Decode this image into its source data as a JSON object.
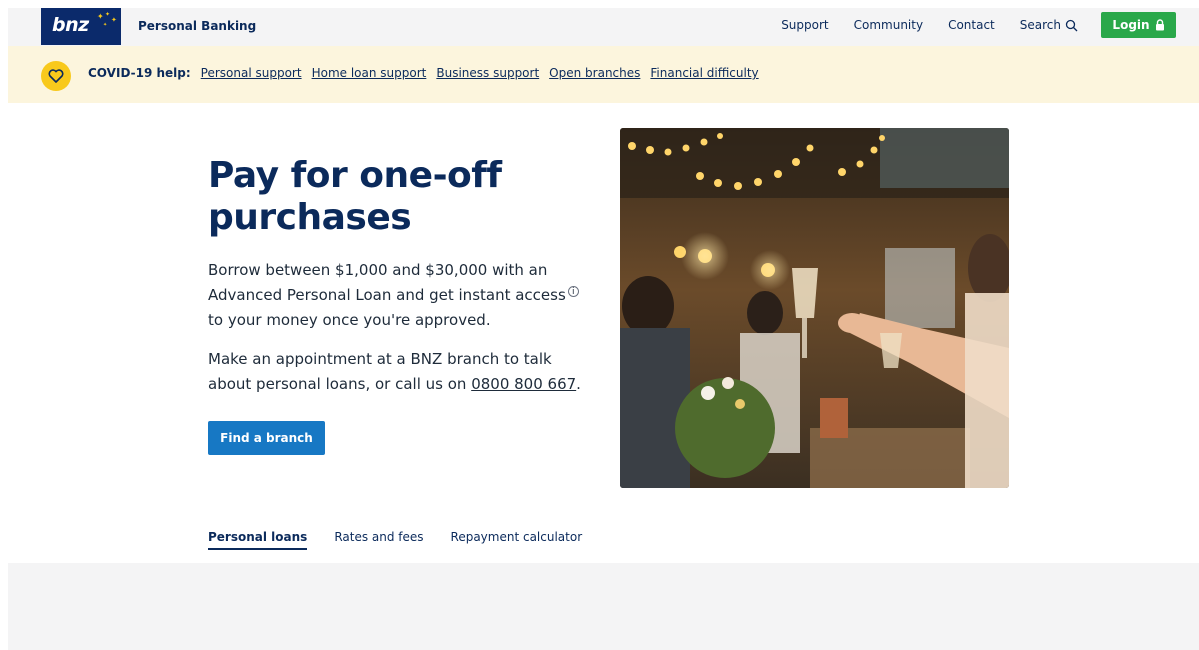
{
  "header": {
    "logo_text": "bnz",
    "product": "Personal Banking",
    "nav": [
      {
        "label": "Support"
      },
      {
        "label": "Community"
      },
      {
        "label": "Contact"
      },
      {
        "label": "Search",
        "icon": "search-icon"
      }
    ],
    "login_label": "Login",
    "login_icon": "lock-icon",
    "brand_color": "#0b2a6b",
    "login_color": "#2aa84a"
  },
  "covid": {
    "icon": "heart-icon",
    "lead": "COVID-19 help:",
    "links": [
      {
        "label": "Personal support"
      },
      {
        "label": "Home loan support"
      },
      {
        "label": "Business support"
      },
      {
        "label": "Open branches"
      },
      {
        "label": "Financial difficulty"
      }
    ],
    "background": "#fcf5dd"
  },
  "hero": {
    "title": "Pay for one-off purchases",
    "p1_before": "Borrow between $1,000 and $30,000 with an Advanced Personal Loan and get instant access",
    "info_glyph": "i",
    "p1_after": " to your money once you're approved.",
    "p2_before": "Make an appointment at a BNZ branch to talk about personal loans, or call us on ",
    "phone": "0800 800 667",
    "p2_after": ".",
    "button_label": "Find a branch",
    "button_color": "#1778c4"
  },
  "tabs": [
    {
      "label": "Personal loans",
      "active": true
    },
    {
      "label": "Rates and fees",
      "active": false
    },
    {
      "label": "Repayment calculator",
      "active": false
    }
  ]
}
